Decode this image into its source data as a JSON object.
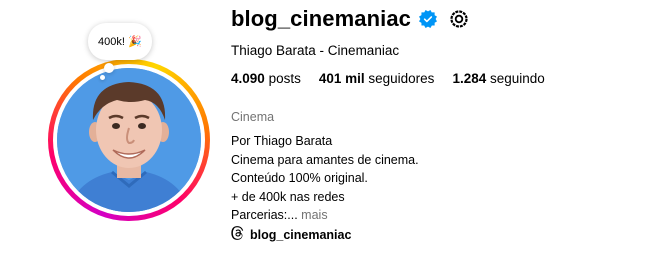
{
  "profile": {
    "username": "blog_cinemaniac",
    "full_name": "Thiago Barata - Cinemaniac",
    "note": "400k! 🎉",
    "stats": {
      "posts_count": "4.090",
      "posts_label": "posts",
      "followers_count": "401 mil",
      "followers_label": "seguidores",
      "following_count": "1.284",
      "following_label": "seguindo"
    },
    "category": "Cinema",
    "bio_lines": [
      "Por Thiago Barata",
      "Cinema para amantes de cinema.",
      "Conteúdo 100% original.",
      "+ de 400k nas redes",
      "Parcerias:..."
    ],
    "more_label": "mais",
    "threads_handle": "blog_cinemaniac"
  },
  "icons": {
    "verified": "verified-badge-icon",
    "threads_circle": "threads-icon",
    "threads_link": "threads-icon"
  },
  "colors": {
    "verified_blue": "#0095f6",
    "secondary_text": "#737373",
    "avatar_background": "#4f9ae6"
  }
}
